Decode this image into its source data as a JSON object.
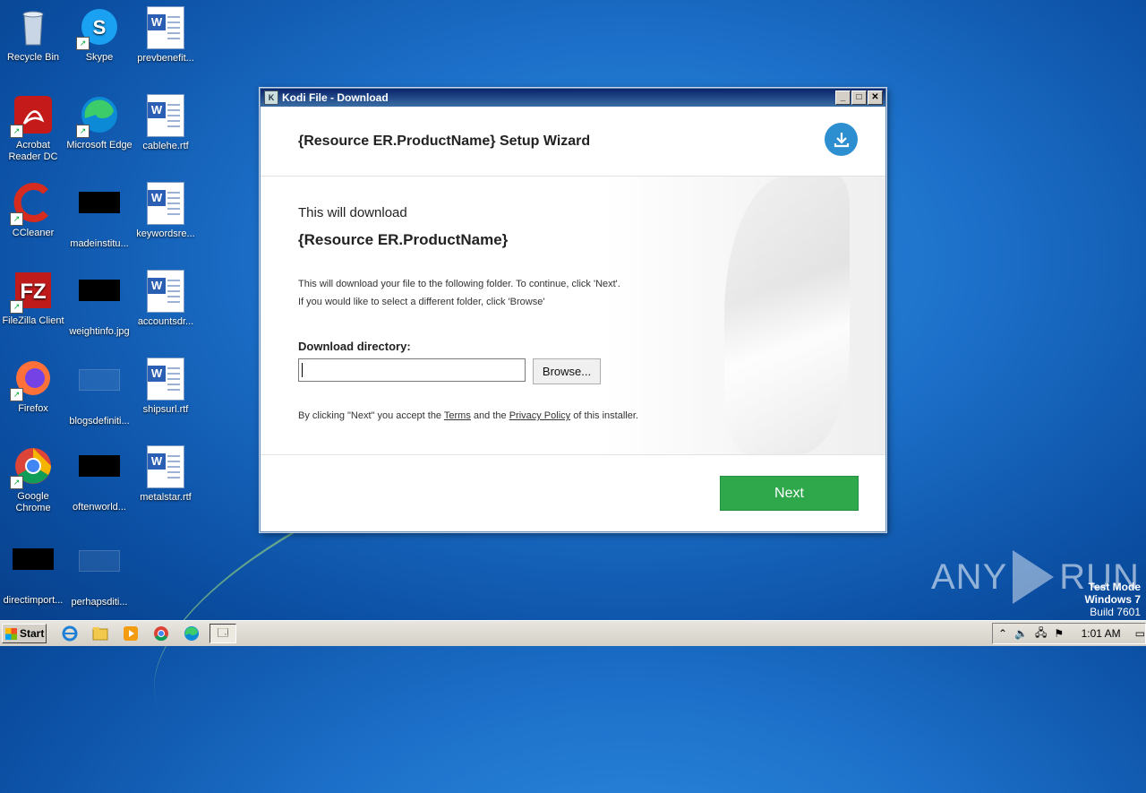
{
  "desktop": {
    "icons": [
      {
        "label": "Recycle Bin",
        "icon": "recycle-bin-icon"
      },
      {
        "label": "Skype",
        "icon": "skype-icon"
      },
      {
        "label": "prevbenefit...",
        "icon": "word-document-icon"
      },
      {
        "label": "Acrobat Reader DC",
        "icon": "acrobat-icon"
      },
      {
        "label": "Microsoft Edge",
        "icon": "edge-icon"
      },
      {
        "label": "cablehe.rtf",
        "icon": "word-document-icon"
      },
      {
        "label": "CCleaner",
        "icon": "ccleaner-icon"
      },
      {
        "label": "madeinstitu...",
        "icon": "image-file-icon"
      },
      {
        "label": "keywordsre...",
        "icon": "word-document-icon"
      },
      {
        "label": "FileZilla Client",
        "icon": "filezilla-icon"
      },
      {
        "label": "weightinfo.jpg",
        "icon": "image-file-icon"
      },
      {
        "label": "accountsdr...",
        "icon": "word-document-icon"
      },
      {
        "label": "Firefox",
        "icon": "firefox-icon"
      },
      {
        "label": "blogsdefiniti...",
        "icon": "file-icon"
      },
      {
        "label": "shipsurl.rtf",
        "icon": "word-document-icon"
      },
      {
        "label": "Google Chrome",
        "icon": "chrome-icon"
      },
      {
        "label": "oftenworld...",
        "icon": "image-file-icon"
      },
      {
        "label": "metalstar.rtf",
        "icon": "word-document-icon"
      },
      {
        "label": "directimport...",
        "icon": "image-file-icon"
      },
      {
        "label": "perhapsditi...",
        "icon": "file-icon"
      }
    ]
  },
  "window": {
    "title": "Kodi File - Download",
    "minimize": "_",
    "maximize": "□",
    "close": "✕",
    "header_title": "{Resource ER.ProductName} Setup Wizard",
    "lead": "This will download",
    "product": "{Resource ER.ProductName}",
    "desc_line1": "This will download your file to the following folder. To continue, click 'Next'.",
    "desc_line2": "If you would like to select a different folder, click 'Browse'",
    "dir_label": "Download directory:",
    "dir_value": "",
    "browse_label": "Browse...",
    "legal_prefix": "By clicking \"Next\" you accept the ",
    "terms_link": "Terms",
    "legal_mid": " and the ",
    "privacy_link": "Privacy Policy",
    "legal_suffix": " of this installer.",
    "next_label": "Next",
    "accent": "#2ea84a",
    "badge_color": "#2d8fd0"
  },
  "watermark": {
    "left": "ANY",
    "right": "RUN",
    "test_mode": "Test Mode",
    "os": "Windows 7",
    "build": "Build 7601"
  },
  "taskbar": {
    "start_label": "Start",
    "clock": "1:01 AM"
  }
}
